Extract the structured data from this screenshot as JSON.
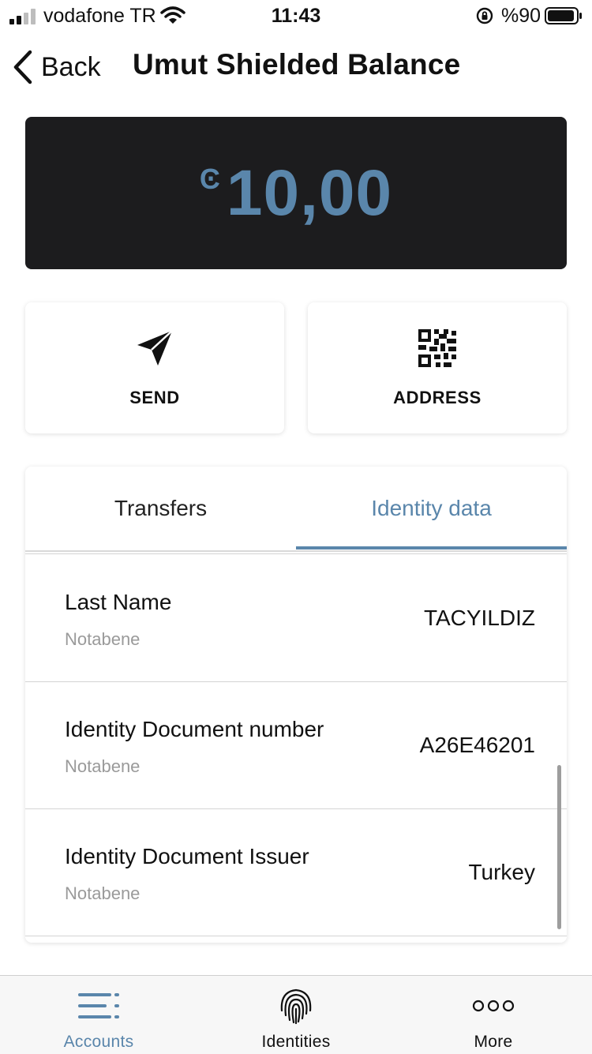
{
  "status_bar": {
    "carrier": "vodafone TR",
    "time": "11:43",
    "battery": "%90"
  },
  "nav": {
    "back_label": "Back",
    "title": "Umut Shielded Balance"
  },
  "balance": {
    "symbol": "Ͼ",
    "amount": "10,00",
    "color": "#5a86ab"
  },
  "actions": {
    "send_label": "SEND",
    "address_label": "ADDRESS"
  },
  "tabs": {
    "transfers": "Transfers",
    "identity": "Identity data",
    "active": "Identity data"
  },
  "identity_rows": [
    {
      "label": "Last Name",
      "provider": "Notabene",
      "value": "TACYILDIZ"
    },
    {
      "label": "Identity Document number",
      "provider": "Notabene",
      "value": "A26E46201"
    },
    {
      "label": "Identity Document Issuer",
      "provider": "Notabene",
      "value": "Turkey"
    }
  ],
  "tabbar": {
    "accounts": "Accounts",
    "identities": "Identities",
    "more": "More",
    "active": "Accounts"
  }
}
